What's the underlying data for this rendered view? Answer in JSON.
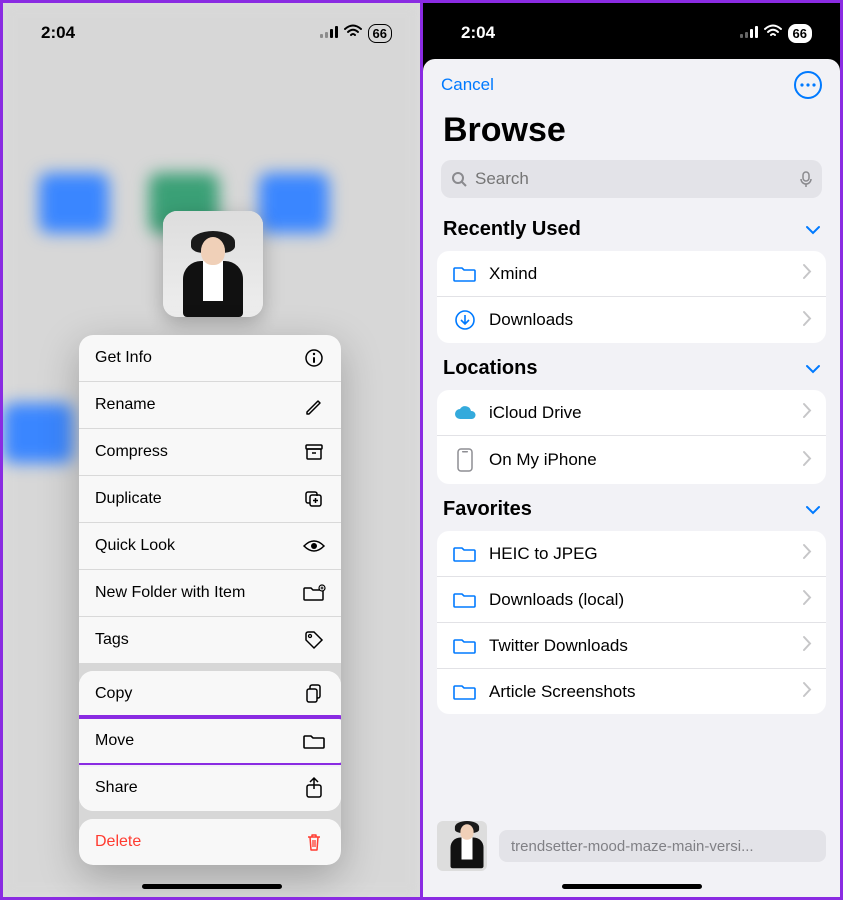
{
  "status": {
    "time": "2:04",
    "battery": "66"
  },
  "context_menu": {
    "group1": [
      {
        "label": "Get Info",
        "icon": "info-circle-icon"
      },
      {
        "label": "Rename",
        "icon": "pencil-icon"
      },
      {
        "label": "Compress",
        "icon": "archive-box-icon"
      },
      {
        "label": "Duplicate",
        "icon": "duplicate-icon"
      },
      {
        "label": "Quick Look",
        "icon": "eye-icon"
      },
      {
        "label": "New Folder with Item",
        "icon": "folder-plus-icon"
      },
      {
        "label": "Tags",
        "icon": "tag-icon"
      }
    ],
    "group2": [
      {
        "label": "Copy",
        "icon": "copy-pages-icon"
      },
      {
        "label": "Move",
        "icon": "folder-icon",
        "highlighted": true
      },
      {
        "label": "Share",
        "icon": "share-icon"
      }
    ],
    "group3": [
      {
        "label": "Delete",
        "icon": "trash-icon",
        "destructive": true
      }
    ]
  },
  "browse": {
    "cancel": "Cancel",
    "title": "Browse",
    "search_placeholder": "Search",
    "sections": {
      "recently_used": {
        "title": "Recently Used",
        "items": [
          {
            "label": "Xmind",
            "icon": "folder-outline-icon"
          },
          {
            "label": "Downloads",
            "icon": "download-circle-icon"
          }
        ]
      },
      "locations": {
        "title": "Locations",
        "items": [
          {
            "label": "iCloud Drive",
            "icon": "cloud-icon"
          },
          {
            "label": "On My iPhone",
            "icon": "iphone-icon",
            "pointed": true
          }
        ]
      },
      "favorites": {
        "title": "Favorites",
        "items": [
          {
            "label": "HEIC to JPEG",
            "icon": "folder-outline-icon"
          },
          {
            "label": "Downloads (local)",
            "icon": "folder-outline-icon"
          },
          {
            "label": "Twitter Downloads",
            "icon": "folder-outline-icon"
          },
          {
            "label": "Article Screenshots",
            "icon": "folder-outline-icon"
          }
        ]
      }
    },
    "selected_file": "trendsetter-mood-maze-main-versi..."
  }
}
